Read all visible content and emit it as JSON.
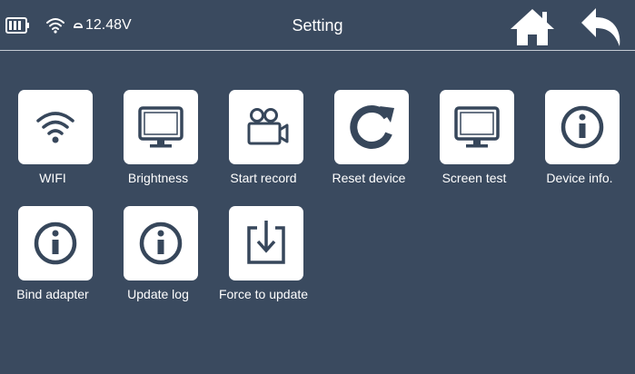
{
  "status": {
    "voltage": "12.48V"
  },
  "header": {
    "title": "Setting"
  },
  "colors": {
    "background": "#3a4a5f",
    "tile": "#ffffff",
    "icon": "#37475b",
    "divider": "#c4cbd4"
  },
  "tiles": [
    {
      "label": "WIFI",
      "icon": "wifi-icon"
    },
    {
      "label": "Brightness",
      "icon": "monitor-icon"
    },
    {
      "label": "Start record",
      "icon": "video-camera-icon"
    },
    {
      "label": "Reset device",
      "icon": "refresh-icon"
    },
    {
      "label": "Screen test",
      "icon": "monitor-icon"
    },
    {
      "label": "Device info.",
      "icon": "info-icon"
    },
    {
      "label": "Bind adapter",
      "icon": "info-icon"
    },
    {
      "label": "Update log",
      "icon": "info-icon"
    },
    {
      "label": "Force to update",
      "icon": "download-icon"
    }
  ]
}
